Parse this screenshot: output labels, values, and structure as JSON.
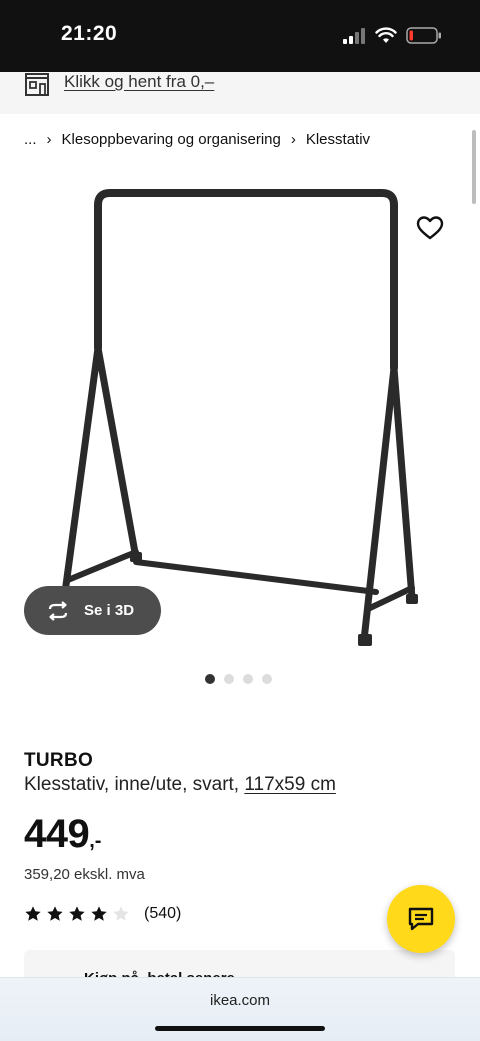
{
  "status_bar": {
    "time": "21:20",
    "icons": [
      "signal-icon",
      "wifi-icon",
      "battery-low-icon"
    ]
  },
  "pickup_banner": {
    "icon": "store-icon",
    "link_text": "Klikk og hent fra 0,–"
  },
  "breadcrumb": {
    "ellipsis": "...",
    "items": [
      "Klesoppbevaring og organisering",
      "Klesstativ"
    ]
  },
  "product": {
    "image_icon": "clothes-rack-image",
    "view_3d_label": "Se i 3D",
    "carousel": {
      "count": 4,
      "active": 1
    },
    "name": "TURBO",
    "description": "Klesstativ, inne/ute, svart,",
    "dimensions": "117x59 cm",
    "price": "449",
    "price_suffix": ",-",
    "price_ex_vat": "359,20 ekskl. mva",
    "rating": {
      "stars": 4,
      "max": 5,
      "count": "(540)"
    }
  },
  "peek_card": {
    "text": "Kjøp nå, betal senere"
  },
  "browser": {
    "url": "ikea.com"
  },
  "colors": {
    "accent_yellow": "#FFD91A",
    "dark_button": "#4D4D4D",
    "status_bar": "#111111"
  }
}
